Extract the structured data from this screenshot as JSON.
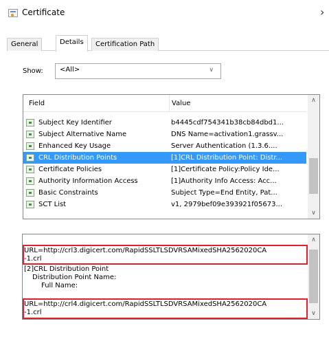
{
  "window": {
    "title": "Certificate",
    "close_glyph": "›"
  },
  "tabs": [
    {
      "label": "General",
      "active": false
    },
    {
      "label": "Details",
      "active": true
    },
    {
      "label": "Certification Path",
      "active": false
    }
  ],
  "show": {
    "label": "Show:",
    "selected": "<All>",
    "chevron": "∨"
  },
  "fields_table": {
    "columns": [
      "Field",
      "Value"
    ],
    "rows": [
      {
        "field": "Subject Key Identifier",
        "value": "b4445cdf754341b38cb84dbd1..."
      },
      {
        "field": "Subject Alternative Name",
        "value": "DNS Name=activation1.grassv..."
      },
      {
        "field": "Enhanced Key Usage",
        "value": "Server Authentication (1.3.6...."
      },
      {
        "field": "CRL Distribution Points",
        "value": "[1]CRL Distribution Point: Distr...",
        "selected": true
      },
      {
        "field": "Certificate Policies",
        "value": "[1]Certificate Policy:Policy Ide..."
      },
      {
        "field": "Authority Information Access",
        "value": "[1]Authority Info Access: Acc..."
      },
      {
        "field": "Basic Constraints",
        "value": "Subject Type=End Entity, Pat..."
      },
      {
        "field": "SCT List",
        "value": "v1, 2979bef09e393921f05673..."
      }
    ],
    "scroll_up": "∧",
    "scroll_down": "∨"
  },
  "detail_text": {
    "lines": [
      "URL=http://crl3.digicert.com/RapidSSLTLSDVRSAMixedSHA2562020CA",
      "-1.crl",
      "[2]CRL Distribution Point",
      "Distribution Point Name:",
      "Full Name:",
      "URL=http://crl4.digicert.com/RapidSSLTLSDVRSAMixedSHA2562020CA",
      "-1.crl"
    ],
    "scroll_up": "∧",
    "scroll_down": "∨"
  },
  "colors": {
    "selection": "#3399ff",
    "highlight_box": "#e0202a"
  },
  "icons": {
    "title": "certificate-icon",
    "row": "certificate-field-icon"
  }
}
